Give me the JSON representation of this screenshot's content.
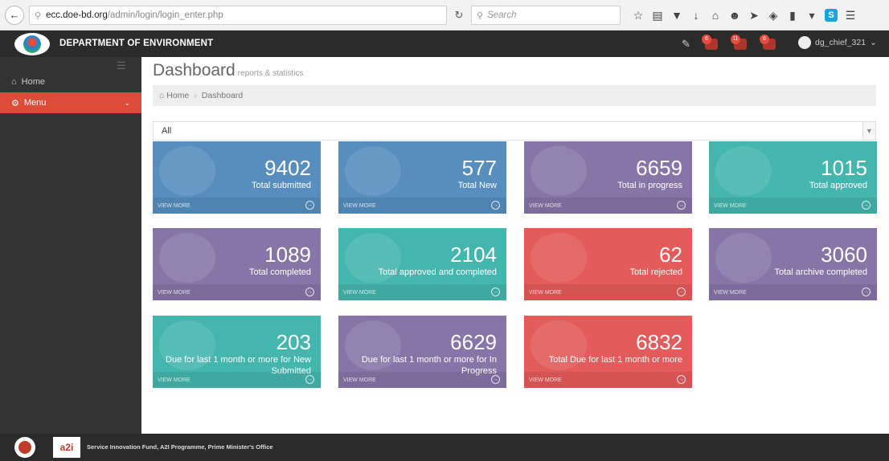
{
  "browser": {
    "url_host": "ecc.doe-bd.org",
    "url_path": "/admin/login/login_enter.php",
    "search_placeholder": "Search",
    "toolbar_icons": [
      "star-icon",
      "reading-list-icon",
      "pocket-icon",
      "download-icon",
      "home-icon",
      "emoji-icon",
      "send-icon",
      "extension-icon",
      "battery-icon",
      "dropdown-icon",
      "skype-icon",
      "menu-icon"
    ]
  },
  "header": {
    "brand": "DEPARTMENT OF ENVIRONMENT",
    "notifications": [
      {
        "count": "6"
      },
      {
        "count": "11"
      },
      {
        "count": "6"
      }
    ],
    "user": "dg_chief_321"
  },
  "sidebar": {
    "items": [
      {
        "label": "Home",
        "icon": "home-icon"
      },
      {
        "label": "Menu",
        "icon": "cogs-icon"
      }
    ]
  },
  "main": {
    "title": "Dashboard",
    "subtitle": "reports & statistics",
    "breadcrumb": {
      "home": "Home",
      "current": "Dashboard"
    },
    "filter_value": "All",
    "view_more": "VIEW MORE",
    "tiles": [
      {
        "value": "9402",
        "label": "Total submitted"
      },
      {
        "value": "577",
        "label": "Total New"
      },
      {
        "value": "6659",
        "label": "Total in progress"
      },
      {
        "value": "1015",
        "label": "Total approved"
      },
      {
        "value": "1089",
        "label": "Total completed"
      },
      {
        "value": "2104",
        "label": "Total approved and completed"
      },
      {
        "value": "62",
        "label": "Total rejected"
      },
      {
        "value": "3060",
        "label": "Total archive completed"
      },
      {
        "value": "203",
        "label": "Due for last 1 month or more for New Submitted"
      },
      {
        "value": "6629",
        "label": "Due for last 1 month or more for In Progress"
      },
      {
        "value": "6832",
        "label": "Total Due for last 1 month or more"
      }
    ]
  },
  "footer": {
    "text": "Service Innovation Fund, A2I Programme, Prime Minister's Office",
    "logo2_text": "a2i"
  },
  "colors": {
    "blue": "#578ebe",
    "purple": "#8775a7",
    "green": "#44b6ae",
    "red": "#e35b5a",
    "header_bg": "#2b2b2b",
    "sidebar_active": "#dd4b39"
  }
}
